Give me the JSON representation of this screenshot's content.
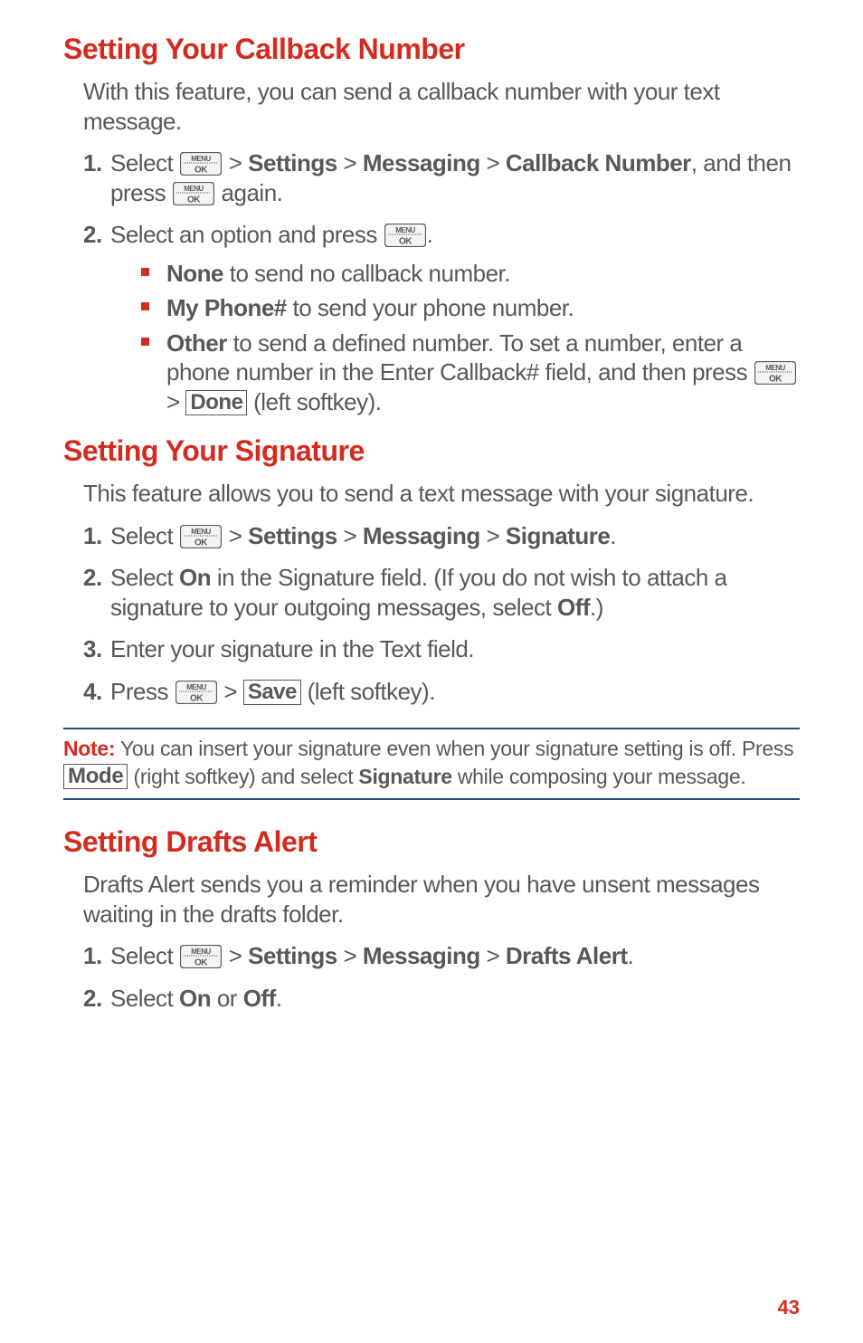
{
  "page_number": "43",
  "sections": [
    {
      "heading": "Setting Your Callback Number",
      "intro": "With this feature, you can send a callback number with your text message.",
      "steps": [
        {
          "pre_select": "Select ",
          "path_a": "Settings",
          "path_b": "Messaging",
          "path_c": "Callback Number",
          "tail_1": ", and then press ",
          "tail_2": " again."
        },
        {
          "text": "Select an option and press ",
          "bullets": [
            {
              "bold": "None",
              "rest": " to send no callback number."
            },
            {
              "bold": "My Phone#",
              "rest": " to send your phone number."
            },
            {
              "bold": "Other",
              "rest_1": " to send a defined number. To set a number, enter a phone number in the Enter Callback# field, and then press ",
              "done_label": "Done",
              "rest_2": " (left softkey)."
            }
          ]
        }
      ]
    },
    {
      "heading": "Setting Your Signature",
      "intro": "This feature allows you to send a text message with your signature.",
      "steps": [
        {
          "pre_select": "Select ",
          "path_a": "Settings",
          "path_b": "Messaging",
          "path_c": "Signature",
          "tail_1": ".",
          "tail_2": ""
        },
        {
          "text_a": "Select ",
          "on": "On",
          "text_b": " in the Signature field. (If you do not wish to attach a signature to your outgoing messages, select ",
          "off": "Off",
          "text_c": ".)"
        },
        {
          "plain": "Enter your signature in the Text field."
        },
        {
          "press": "Press ",
          "save_label": "Save",
          "after": " (left softkey)."
        }
      ]
    },
    {
      "heading": "Setting Drafts Alert",
      "intro": "Drafts Alert sends you a reminder when you have unsent messages waiting in the drafts folder.",
      "steps": [
        {
          "pre_select": "Select ",
          "path_a": "Settings",
          "path_b": "Messaging",
          "path_c": "Drafts Alert",
          "tail_1": ".",
          "tail_2": ""
        },
        {
          "text_a": "Select ",
          "on": "On",
          "or": " or ",
          "off": "Off",
          "text_c": "."
        }
      ]
    }
  ],
  "note": {
    "label": "Note:",
    "text_1": " You can insert your signature even when your signature setting is off. Press ",
    "mode_label": "Mode",
    "text_2": " (right softkey) and select ",
    "sig": "Signature",
    "text_3": " while composing your message."
  }
}
